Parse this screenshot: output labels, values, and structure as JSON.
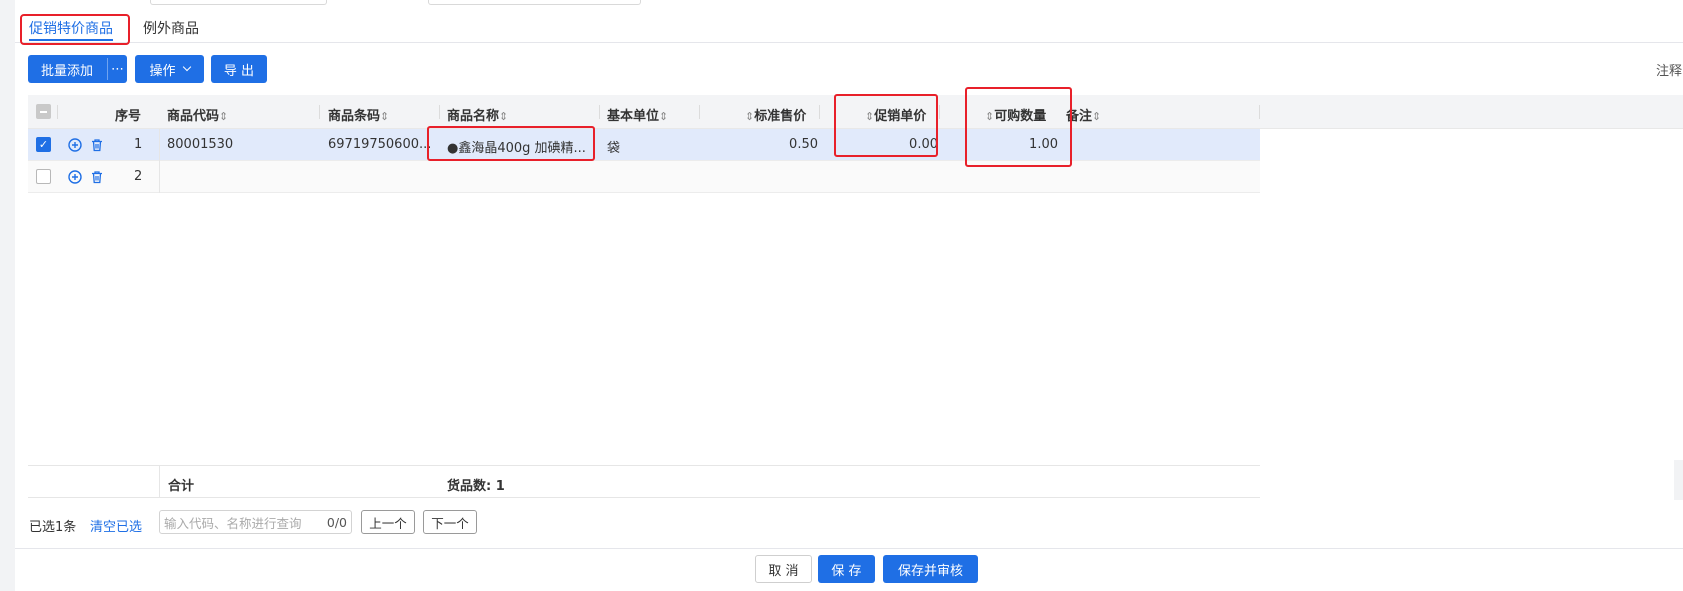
{
  "tabs": [
    {
      "label": "促销特价商品",
      "active": true
    },
    {
      "label": "例外商品",
      "active": false
    }
  ],
  "toolbar": {
    "batch_add_label": "批量添加",
    "more_label": "⋯",
    "operate_label": "操作",
    "export_label": "导 出"
  },
  "top_right_note": "注释",
  "grid": {
    "headers": {
      "index": "序号",
      "code": "商品代码",
      "barcode": "商品条码",
      "name": "商品名称",
      "unit": "基本单位",
      "std_price": "标准售价",
      "promo_price": "促销单价",
      "qty": "可购数量",
      "remark": "备注"
    },
    "sort_icon": "⇕",
    "rows": [
      {
        "checked": true,
        "index": "1",
        "code": "80001530",
        "barcode": "69719750600...",
        "name": "●鑫海晶400g 加碘精...",
        "unit": "袋",
        "std_price": "0.50",
        "promo_price": "0.00",
        "qty": "1.00",
        "remark": ""
      },
      {
        "checked": false,
        "index": "2",
        "code": "",
        "barcode": "",
        "name": "",
        "unit": "",
        "std_price": "",
        "promo_price": "",
        "qty": "",
        "remark": ""
      }
    ],
    "footer": {
      "total_label": "合计",
      "goods_count": "货品数: 1"
    }
  },
  "selection": {
    "selected_text": "已选1条",
    "clear_label": "清空已选",
    "search_placeholder": "输入代码、名称进行查询",
    "search_count": "0/0",
    "prev_label": "上一个",
    "next_label": "下一个"
  },
  "actions": {
    "cancel_label": "取 消",
    "save_label": "保 存",
    "save_audit_label": "保存并审核"
  },
  "colors": {
    "primary": "#1f6fe5",
    "annotation": "#e8202a",
    "selected_row": "#e1eafb"
  }
}
